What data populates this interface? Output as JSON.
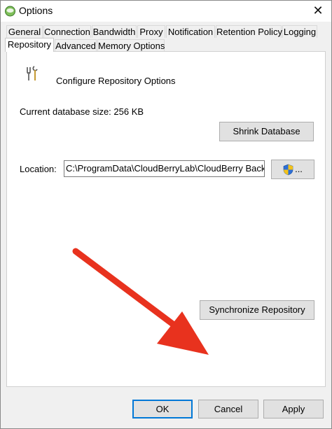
{
  "window": {
    "title": "Options",
    "close_glyph": "✕"
  },
  "tabs": {
    "row1": [
      "General",
      "Connection",
      "Bandwidth",
      "Proxy",
      "Notification",
      "Retention Policy",
      "Logging"
    ],
    "row2": [
      "Repository",
      "Advanced",
      "Memory Options"
    ],
    "active": "Repository"
  },
  "panel": {
    "heading": "Configure Repository Options",
    "db_size_label": "Current database size: 256 KB",
    "shrink_label": "Shrink Database",
    "location_label": "Location:",
    "location_value": "C:\\ProgramData\\CloudBerryLab\\CloudBerry Backup",
    "browse_label": "...",
    "sync_label": "Synchronize Repository"
  },
  "footer": {
    "ok_label": "OK",
    "cancel_label": "Cancel",
    "apply_label": "Apply"
  },
  "icons": {
    "app": "cloudberry-app-icon",
    "tools": "tools-icon",
    "shield": "uac-shield-icon",
    "arrow": "red-arrow-annotation"
  },
  "colors": {
    "arrow": "#e8321e",
    "ok_border": "#0078d7"
  }
}
